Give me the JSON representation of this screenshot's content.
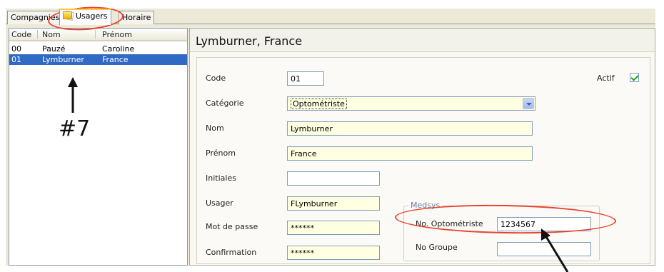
{
  "tabs": [
    {
      "label": "Compagnies",
      "active": false
    },
    {
      "label": "Usagers",
      "active": true,
      "icon": "folder-icon"
    },
    {
      "label": "Horaire",
      "active": false
    }
  ],
  "list": {
    "columns": [
      "Code",
      "Nom",
      "Prénom"
    ],
    "rows": [
      {
        "code": "00",
        "nom": "Pauzé",
        "prenom": "Caroline",
        "selected": false
      },
      {
        "code": "01",
        "nom": "Lymburner",
        "prenom": "France",
        "selected": true
      }
    ]
  },
  "detail": {
    "title": "Lymburner, France",
    "code": {
      "label": "Code",
      "value": "01"
    },
    "actif": {
      "label": "Actif",
      "checked": true
    },
    "categorie": {
      "label": "Catégorie",
      "value": "Optométriste"
    },
    "nom": {
      "label": "Nom",
      "value": "Lymburner"
    },
    "prenom": {
      "label": "Prénom",
      "value": "France"
    },
    "initiales": {
      "label": "Initiales",
      "value": ""
    },
    "usager": {
      "label": "Usager",
      "value": "FLymburner"
    },
    "mot_de_passe": {
      "label": "Mot de passe",
      "value": "******"
    },
    "confirmation": {
      "label": "Confirmation",
      "value": "******"
    },
    "medsys": {
      "legend": "Medsys",
      "no_optometriste": {
        "label": "No. Optométriste",
        "value": "1234567"
      },
      "no_groupe": {
        "label": "No Groupe",
        "value": ""
      }
    }
  },
  "annotations": {
    "marker_label": "#7",
    "color": "#e8432c"
  },
  "colors": {
    "selection": "#316ac5",
    "required_field": "#ffffe1",
    "window_bg": "#ece9d8"
  }
}
